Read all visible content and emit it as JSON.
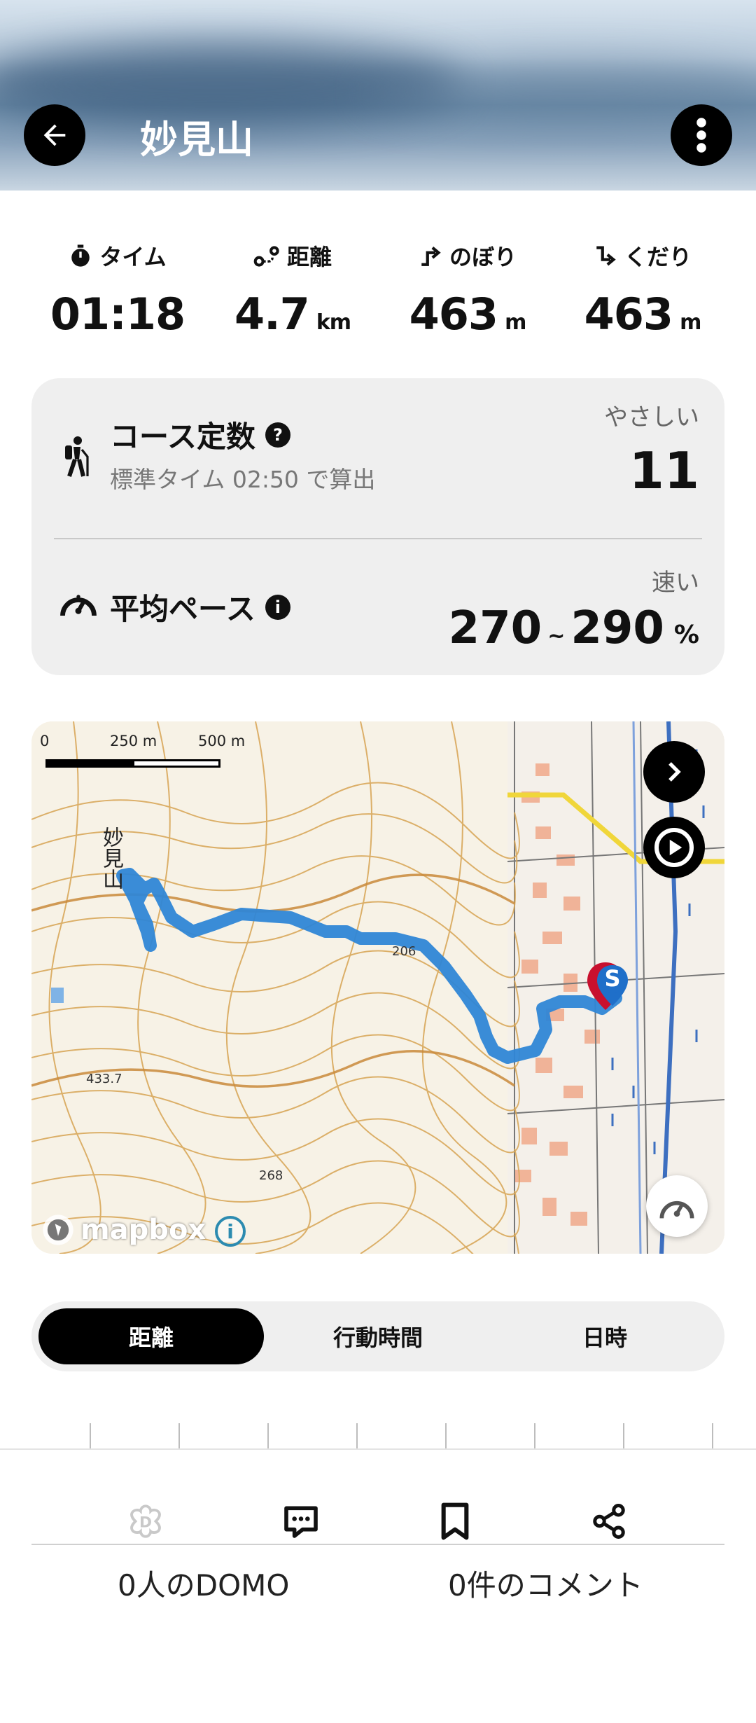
{
  "header": {
    "title": "妙見山",
    "back_icon": "arrow-left-icon",
    "menu_icon": "more-vertical-icon"
  },
  "stats": [
    {
      "label": "タイム",
      "value": "01:18",
      "unit": "",
      "icon": "stopwatch-icon"
    },
    {
      "label": "距離",
      "value": "4.7",
      "unit": "km",
      "icon": "route-icon"
    },
    {
      "label": "のぼり",
      "value": "463",
      "unit": "m",
      "icon": "ascent-icon"
    },
    {
      "label": "くだり",
      "value": "463",
      "unit": "m",
      "icon": "descent-icon"
    }
  ],
  "course": {
    "label": "コース定数",
    "help": "?",
    "sub": "標準タイム 02:50 で算出",
    "difficulty": "やさしい",
    "value": "11"
  },
  "pace": {
    "label": "平均ペース",
    "info": "i",
    "speed_label": "速い",
    "min": "270",
    "tilde": "~",
    "max": "290",
    "unit": "%"
  },
  "map": {
    "scale_labels": [
      "0",
      "250 m",
      "500 m"
    ],
    "peak_label": "妙見山",
    "spot_heights": [
      "206",
      "433.7",
      "268"
    ],
    "start_marker": "S",
    "attribution": "mapbox",
    "attribution_info": "i"
  },
  "tabs": [
    {
      "label": "距離",
      "active": true
    },
    {
      "label": "行動時間",
      "active": false
    },
    {
      "label": "日時",
      "active": false
    }
  ],
  "footer": {
    "domo_text": "0人のDOMO",
    "comment_text": "0件のコメント"
  },
  "colors": {
    "route": "#2f86d6",
    "marker_red": "#c8102e",
    "marker_blue": "#1f6fc9",
    "contour": "#d9a85b"
  }
}
